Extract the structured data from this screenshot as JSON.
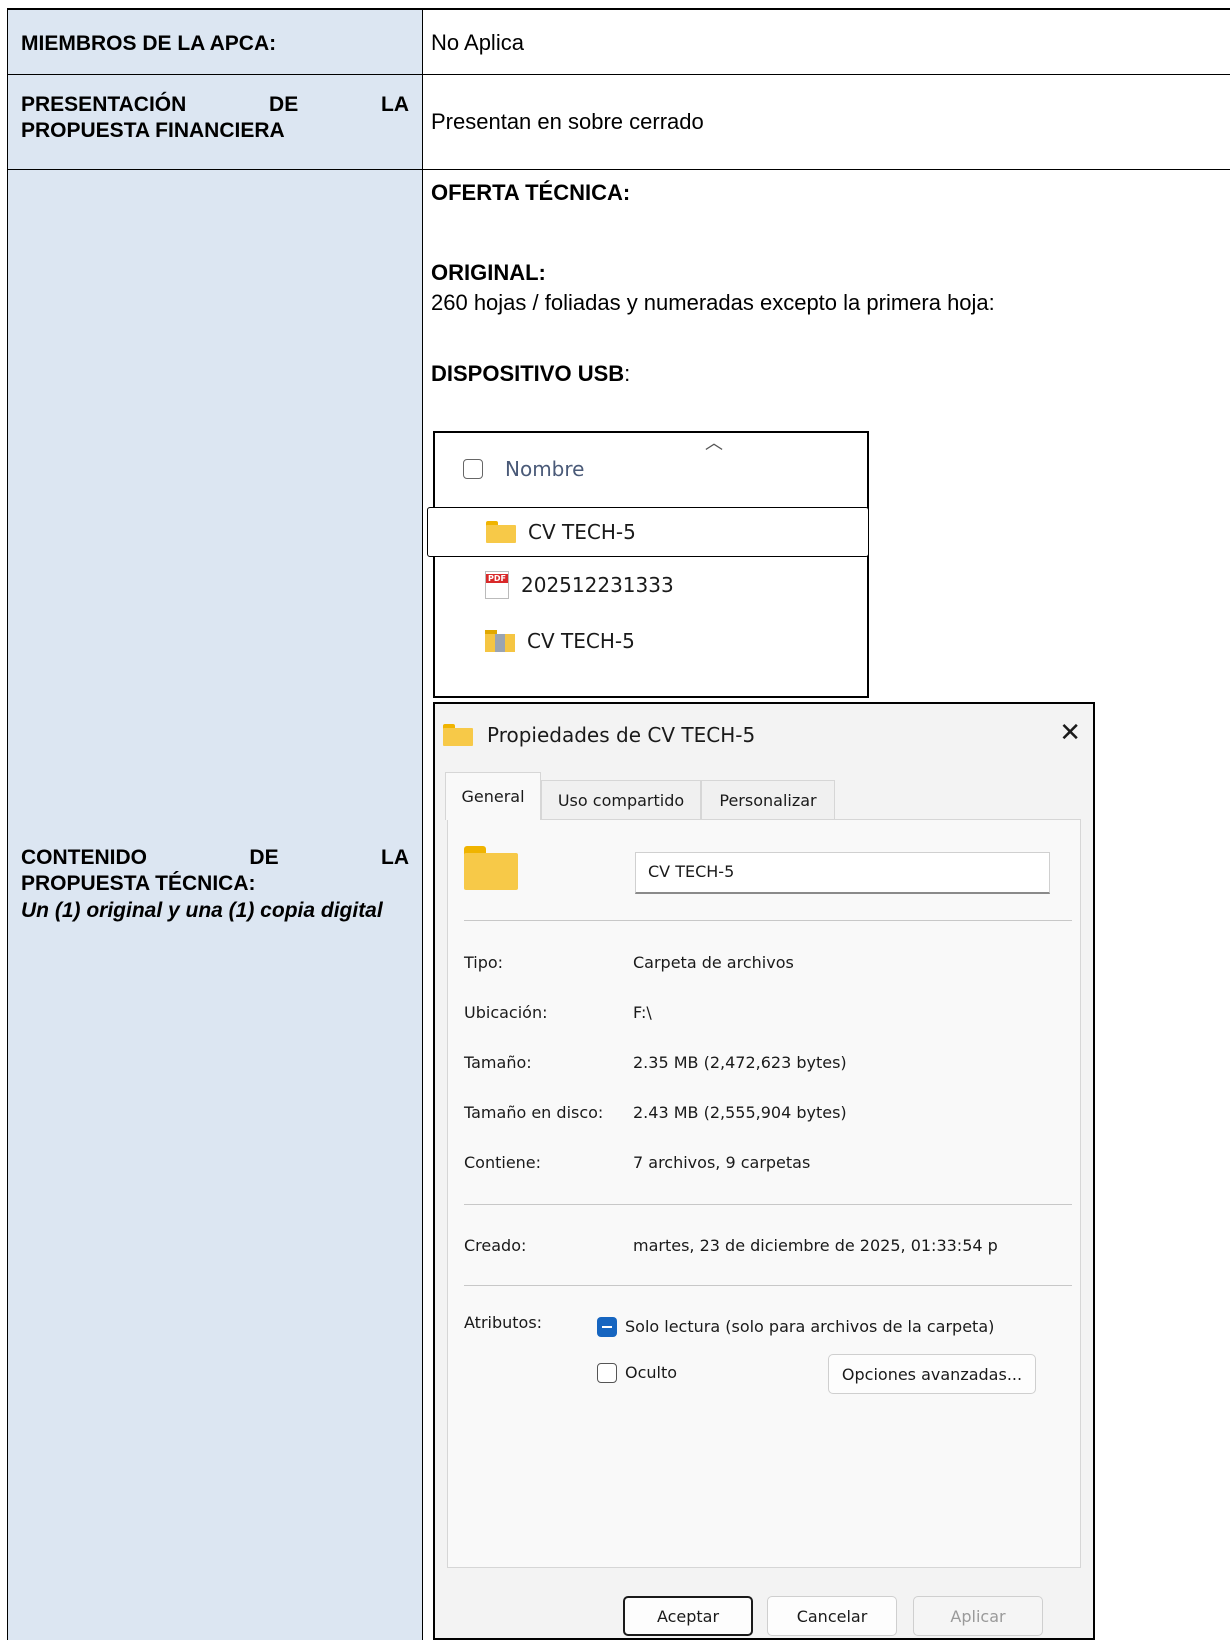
{
  "rows": {
    "apca_label": "MIEMBROS DE LA APCA:",
    "apca_value": "No Aplica",
    "financiera_label_1": "PRESENTACIÓN DE LA",
    "financiera_label_2": "PROPUESTA FINANCIERA",
    "financiera_value": "Presentan en sobre cerrado",
    "tecnica_label_1": "CONTENIDO DE LA",
    "tecnica_label_2": "PROPUESTA TÉCNICA:",
    "tecnica_note": "Un (1) original y una (1) copia digital"
  },
  "content": {
    "oferta_heading": "OFERTA TÉCNICA:",
    "original_heading": "ORIGINAL:",
    "original_text": "260 hojas / foliadas y numeradas excepto la primera hoja:",
    "usb_heading": "DISPOSITIVO USB",
    "usb_colon": ":"
  },
  "explorer": {
    "column_header": "Nombre",
    "items": [
      {
        "name": "CV TECH-5",
        "icon": "folder-icon"
      },
      {
        "name": "202512231333",
        "icon": "pdf-icon"
      },
      {
        "name": "CV TECH-5",
        "icon": "zip-folder-icon"
      }
    ]
  },
  "dialog": {
    "title": "Propiedades de CV TECH-5",
    "close_glyph": "✕",
    "tabs": [
      "General",
      "Uso compartido",
      "Personalizar"
    ],
    "name_value": "CV TECH-5",
    "properties": [
      {
        "label": "Tipo:",
        "value": "Carpeta de archivos"
      },
      {
        "label": "Ubicación:",
        "value": "F:\\"
      },
      {
        "label": "Tamaño:",
        "value": "2.35 MB (2,472,623 bytes)"
      },
      {
        "label": "Tamaño en disco:",
        "value": "2.43 MB (2,555,904 bytes)"
      },
      {
        "label": "Contiene:",
        "value": "7 archivos, 9 carpetas"
      }
    ],
    "created_label": "Creado:",
    "created_value": "martes, 23 de diciembre de 2025, 01:33:54 p",
    "attributes_label": "Atributos:",
    "readonly_label": "Solo lectura (solo para archivos de la carpeta)",
    "hidden_label": "Oculto",
    "advanced_button": "Opciones avanzadas...",
    "ok_button": "Aceptar",
    "cancel_button": "Cancelar",
    "apply_button": "Aplicar"
  }
}
